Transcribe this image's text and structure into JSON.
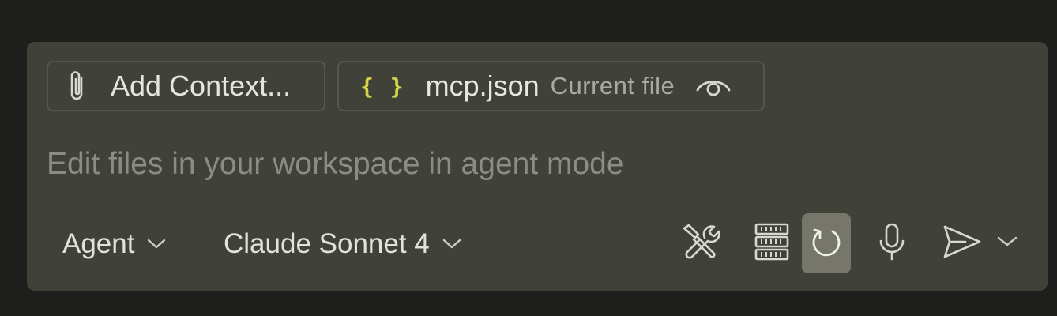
{
  "context": {
    "add_context_label": "Add Context...",
    "file_chip": {
      "braces": "{ }",
      "filename": "mcp.json",
      "description": "Current file"
    }
  },
  "prompt": {
    "placeholder": "Edit files in your workspace in agent mode",
    "value": ""
  },
  "toolbar": {
    "mode_label": "Agent",
    "model_label": "Claude Sonnet 4",
    "icons": [
      "paperclip-icon",
      "json-braces-icon",
      "eye-icon",
      "tools-icon",
      "server-icon",
      "refresh-icon",
      "microphone-icon",
      "send-icon",
      "chevron-down-icon"
    ]
  },
  "colors": {
    "background": "#1e1e1c",
    "panel": "#40423a",
    "chip_border": "#55574f",
    "json_icon": "#d6d24a",
    "active_button": "#77766a",
    "placeholder": "#8b8c85"
  }
}
